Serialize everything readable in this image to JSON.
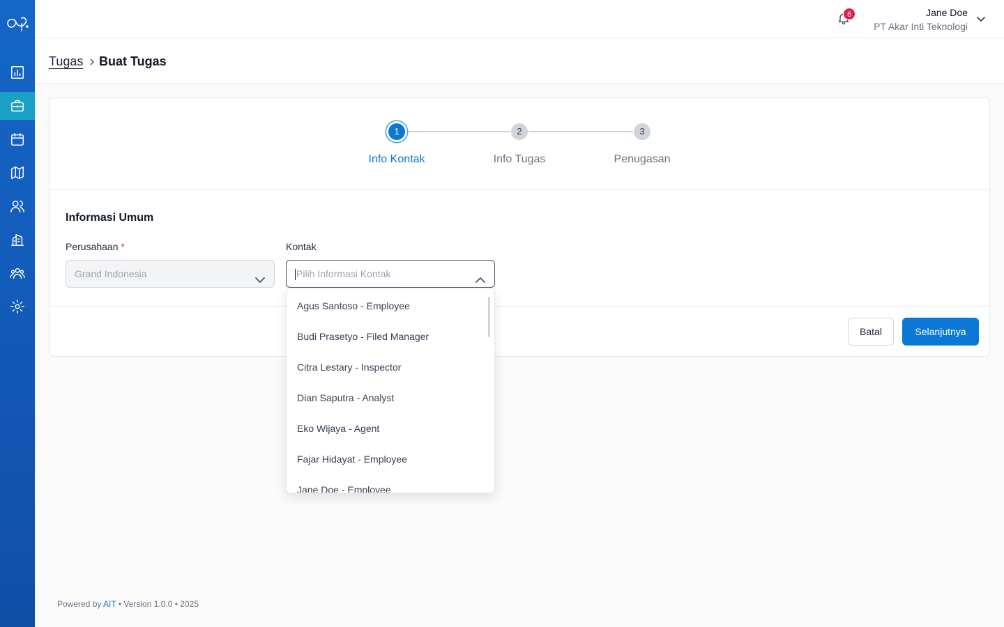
{
  "header": {
    "notification_count": "6",
    "user_name": "Jane Doe",
    "user_company": "PT Akar Inti Teknologi"
  },
  "breadcrumb": {
    "parent": "Tugas",
    "current": "Buat Tugas"
  },
  "stepper": {
    "steps": [
      {
        "number": "1",
        "label": "Info Kontak",
        "active": true
      },
      {
        "number": "2",
        "label": "Info Tugas",
        "active": false
      },
      {
        "number": "3",
        "label": "Penugasan",
        "active": false
      }
    ]
  },
  "form": {
    "section_title": "Informasi Umum",
    "company": {
      "label": "Perusahaan",
      "required_mark": "*",
      "value": "Grand Indonesia"
    },
    "contact": {
      "label": "Kontak",
      "placeholder": "Pilih Informasi Kontak"
    },
    "contact_options": [
      "Agus Santoso - Employee",
      "Budi Prasetyo - Filed Manager",
      "Citra Lestary - Inspector",
      "Dian Saputra - Analyst",
      "Eko Wijaya - Agent",
      "Fajar Hidayat - Employee",
      "Jane Doe - Employee"
    ]
  },
  "actions": {
    "cancel_label": "Batal",
    "next_label": "Selanjutnya"
  },
  "footer": {
    "powered_prefix": "Powered by",
    "powered_brand": "AIT",
    "powered_suffix": "• Version 1.0.0 • 2025"
  },
  "colors": {
    "primary": "#0b78d6",
    "sidebar": "#1566c7",
    "sidebar_active": "#1a9fc7",
    "badge": "#e11d48"
  },
  "icons": {
    "sidebar": [
      "logo-icon",
      "dashboard-chart-icon",
      "briefcase-icon",
      "calendar-icon",
      "map-icon",
      "users-icon",
      "building-icon",
      "team-icon",
      "settings-icon"
    ],
    "header": [
      "bell-icon",
      "chevron-down-icon"
    ]
  }
}
